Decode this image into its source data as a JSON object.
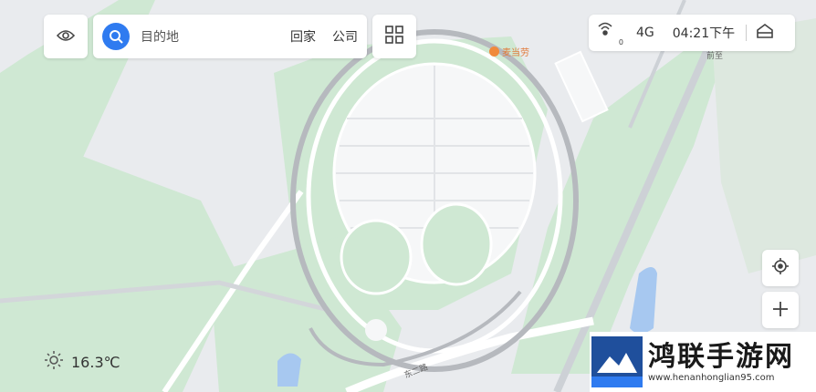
{
  "search": {
    "placeholder": "目的地",
    "shortcuts": [
      "回家",
      "公司"
    ]
  },
  "status": {
    "signal_count": "0",
    "network": "4G",
    "time": "04:21下午"
  },
  "weather": {
    "temperature": "16.3℃"
  },
  "map_labels": {
    "poi": "麦当劳",
    "road": "东二路",
    "nearby": "前至"
  },
  "watermark": {
    "title": "鸿联手游网",
    "url": "www.henanhonglian95.com"
  },
  "icons": {
    "eye": "eye-icon",
    "search": "search-icon",
    "apps": "grid-icon",
    "signal": "signal-icon",
    "home": "home-icon",
    "locate": "locate-icon",
    "zoom_in": "plus-icon",
    "weather": "sun-icon"
  },
  "colors": {
    "accent": "#2f7bf0",
    "park": "#cfe8d3",
    "road": "#ffffff",
    "base": "#e9ebee"
  }
}
